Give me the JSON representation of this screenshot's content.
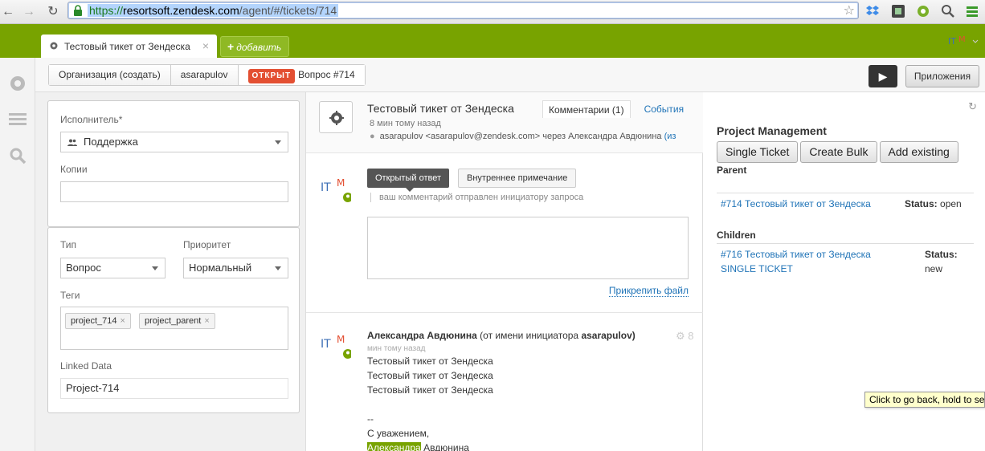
{
  "browser": {
    "url_scheme": "https://",
    "url_host": "resortsoft.zendesk.com",
    "url_path": "/agent/#/tickets/714"
  },
  "tabs": {
    "active_title": "Тестовый тикет от Зендеска",
    "add_label": "добавить"
  },
  "subheader": {
    "organization": "Организация (создать)",
    "requester": "asarapulov",
    "status": "ОТКРЫТ",
    "ticket_ref": "Вопрос #714",
    "apps_button": "Приложения"
  },
  "properties": {
    "assignee_label": "Исполнитель*",
    "assignee_value": "Поддержка",
    "cc_label": "Копии",
    "type_label": "Тип",
    "type_value": "Вопрос",
    "priority_label": "Приоритет",
    "priority_value": "Нормальный",
    "tags_label": "Теги",
    "tags": [
      "project_714",
      "project_parent"
    ],
    "linked_label": "Linked Data",
    "linked_value": "Project-714"
  },
  "ticket": {
    "title": "Тестовый тикет от Зендеска",
    "tab_comments": "Комментарии (1)",
    "tab_events": "События",
    "time_ago": "8 мин тому назад",
    "requester_line": "asarapulov <asarapulov@zendesk.com> через Александра Авдюнина",
    "requester_link": "(из"
  },
  "reply": {
    "public_label": "Открытый ответ",
    "internal_label": "Внутреннее примечание",
    "hint": "ваш комментарий отправлен инициатору запроса",
    "attach_label": "Прикрепить файл"
  },
  "comment": {
    "author": "Александра Авдюнина",
    "on_behalf_prefix": "(от имени инициатора",
    "on_behalf_user": "asarapulov)",
    "time": "мин тому назад",
    "time_num": "8",
    "lines": [
      "Тестовый тикет от Зендеска",
      "Тестовый тикет от Зендеска",
      "Тестовый тикет от Зендеска"
    ],
    "sep": "--",
    "regards": "С уважением,",
    "sign_first": "Александра",
    "sign_last": "Авдюнина"
  },
  "project_management": {
    "title": "Project Management",
    "btn_single": "Single Ticket",
    "btn_bulk": "Create Bulk",
    "btn_existing": "Add existing",
    "parent_label": "Parent",
    "parent_link": "#714 Тестовый тикет от Зендеска",
    "parent_status_label": "Status:",
    "parent_status_value": "open",
    "children_label": "Children",
    "child_link_1": "#716 Тестовый тикет от Зендеска",
    "child_link_2": "SINGLE TICKET",
    "child_status_label": "Status:",
    "child_status_value": "new"
  },
  "tooltip": "Click to go back, hold to see history",
  "colors": {
    "brand_green": "#78a300",
    "status_red": "#e34f32",
    "link_blue": "#1f73b7"
  }
}
